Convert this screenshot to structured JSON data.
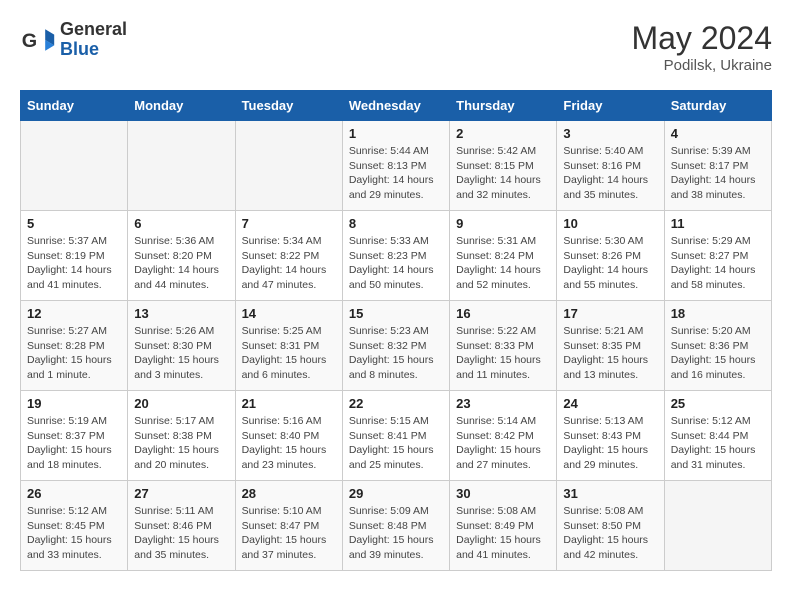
{
  "header": {
    "logo_general": "General",
    "logo_blue": "Blue",
    "month_year": "May 2024",
    "location": "Podilsk, Ukraine"
  },
  "days_of_week": [
    "Sunday",
    "Monday",
    "Tuesday",
    "Wednesday",
    "Thursday",
    "Friday",
    "Saturday"
  ],
  "weeks": [
    [
      {
        "day": "",
        "empty": true
      },
      {
        "day": "",
        "empty": true
      },
      {
        "day": "",
        "empty": true
      },
      {
        "day": "1",
        "lines": [
          "Sunrise: 5:44 AM",
          "Sunset: 8:13 PM",
          "Daylight: 14 hours",
          "and 29 minutes."
        ]
      },
      {
        "day": "2",
        "lines": [
          "Sunrise: 5:42 AM",
          "Sunset: 8:15 PM",
          "Daylight: 14 hours",
          "and 32 minutes."
        ]
      },
      {
        "day": "3",
        "lines": [
          "Sunrise: 5:40 AM",
          "Sunset: 8:16 PM",
          "Daylight: 14 hours",
          "and 35 minutes."
        ]
      },
      {
        "day": "4",
        "lines": [
          "Sunrise: 5:39 AM",
          "Sunset: 8:17 PM",
          "Daylight: 14 hours",
          "and 38 minutes."
        ]
      }
    ],
    [
      {
        "day": "5",
        "lines": [
          "Sunrise: 5:37 AM",
          "Sunset: 8:19 PM",
          "Daylight: 14 hours",
          "and 41 minutes."
        ]
      },
      {
        "day": "6",
        "lines": [
          "Sunrise: 5:36 AM",
          "Sunset: 8:20 PM",
          "Daylight: 14 hours",
          "and 44 minutes."
        ]
      },
      {
        "day": "7",
        "lines": [
          "Sunrise: 5:34 AM",
          "Sunset: 8:22 PM",
          "Daylight: 14 hours",
          "and 47 minutes."
        ]
      },
      {
        "day": "8",
        "lines": [
          "Sunrise: 5:33 AM",
          "Sunset: 8:23 PM",
          "Daylight: 14 hours",
          "and 50 minutes."
        ]
      },
      {
        "day": "9",
        "lines": [
          "Sunrise: 5:31 AM",
          "Sunset: 8:24 PM",
          "Daylight: 14 hours",
          "and 52 minutes."
        ]
      },
      {
        "day": "10",
        "lines": [
          "Sunrise: 5:30 AM",
          "Sunset: 8:26 PM",
          "Daylight: 14 hours",
          "and 55 minutes."
        ]
      },
      {
        "day": "11",
        "lines": [
          "Sunrise: 5:29 AM",
          "Sunset: 8:27 PM",
          "Daylight: 14 hours",
          "and 58 minutes."
        ]
      }
    ],
    [
      {
        "day": "12",
        "lines": [
          "Sunrise: 5:27 AM",
          "Sunset: 8:28 PM",
          "Daylight: 15 hours",
          "and 1 minute."
        ]
      },
      {
        "day": "13",
        "lines": [
          "Sunrise: 5:26 AM",
          "Sunset: 8:30 PM",
          "Daylight: 15 hours",
          "and 3 minutes."
        ]
      },
      {
        "day": "14",
        "lines": [
          "Sunrise: 5:25 AM",
          "Sunset: 8:31 PM",
          "Daylight: 15 hours",
          "and 6 minutes."
        ]
      },
      {
        "day": "15",
        "lines": [
          "Sunrise: 5:23 AM",
          "Sunset: 8:32 PM",
          "Daylight: 15 hours",
          "and 8 minutes."
        ]
      },
      {
        "day": "16",
        "lines": [
          "Sunrise: 5:22 AM",
          "Sunset: 8:33 PM",
          "Daylight: 15 hours",
          "and 11 minutes."
        ]
      },
      {
        "day": "17",
        "lines": [
          "Sunrise: 5:21 AM",
          "Sunset: 8:35 PM",
          "Daylight: 15 hours",
          "and 13 minutes."
        ]
      },
      {
        "day": "18",
        "lines": [
          "Sunrise: 5:20 AM",
          "Sunset: 8:36 PM",
          "Daylight: 15 hours",
          "and 16 minutes."
        ]
      }
    ],
    [
      {
        "day": "19",
        "lines": [
          "Sunrise: 5:19 AM",
          "Sunset: 8:37 PM",
          "Daylight: 15 hours",
          "and 18 minutes."
        ]
      },
      {
        "day": "20",
        "lines": [
          "Sunrise: 5:17 AM",
          "Sunset: 8:38 PM",
          "Daylight: 15 hours",
          "and 20 minutes."
        ]
      },
      {
        "day": "21",
        "lines": [
          "Sunrise: 5:16 AM",
          "Sunset: 8:40 PM",
          "Daylight: 15 hours",
          "and 23 minutes."
        ]
      },
      {
        "day": "22",
        "lines": [
          "Sunrise: 5:15 AM",
          "Sunset: 8:41 PM",
          "Daylight: 15 hours",
          "and 25 minutes."
        ]
      },
      {
        "day": "23",
        "lines": [
          "Sunrise: 5:14 AM",
          "Sunset: 8:42 PM",
          "Daylight: 15 hours",
          "and 27 minutes."
        ]
      },
      {
        "day": "24",
        "lines": [
          "Sunrise: 5:13 AM",
          "Sunset: 8:43 PM",
          "Daylight: 15 hours",
          "and 29 minutes."
        ]
      },
      {
        "day": "25",
        "lines": [
          "Sunrise: 5:12 AM",
          "Sunset: 8:44 PM",
          "Daylight: 15 hours",
          "and 31 minutes."
        ]
      }
    ],
    [
      {
        "day": "26",
        "lines": [
          "Sunrise: 5:12 AM",
          "Sunset: 8:45 PM",
          "Daylight: 15 hours",
          "and 33 minutes."
        ]
      },
      {
        "day": "27",
        "lines": [
          "Sunrise: 5:11 AM",
          "Sunset: 8:46 PM",
          "Daylight: 15 hours",
          "and 35 minutes."
        ]
      },
      {
        "day": "28",
        "lines": [
          "Sunrise: 5:10 AM",
          "Sunset: 8:47 PM",
          "Daylight: 15 hours",
          "and 37 minutes."
        ]
      },
      {
        "day": "29",
        "lines": [
          "Sunrise: 5:09 AM",
          "Sunset: 8:48 PM",
          "Daylight: 15 hours",
          "and 39 minutes."
        ]
      },
      {
        "day": "30",
        "lines": [
          "Sunrise: 5:08 AM",
          "Sunset: 8:49 PM",
          "Daylight: 15 hours",
          "and 41 minutes."
        ]
      },
      {
        "day": "31",
        "lines": [
          "Sunrise: 5:08 AM",
          "Sunset: 8:50 PM",
          "Daylight: 15 hours",
          "and 42 minutes."
        ]
      },
      {
        "day": "",
        "empty": true
      }
    ]
  ]
}
